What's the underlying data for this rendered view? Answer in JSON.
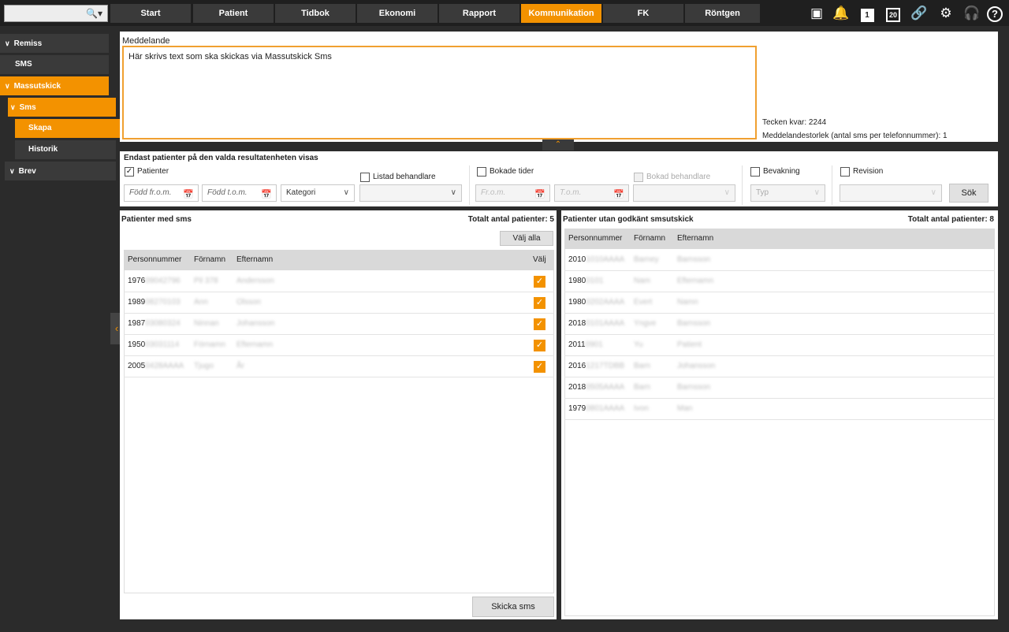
{
  "topbar": {
    "tabs": [
      {
        "label": "Start",
        "active": false
      },
      {
        "label": "Patient",
        "active": false
      },
      {
        "label": "Tidbok",
        "active": false
      },
      {
        "label": "Ekonomi",
        "active": false
      },
      {
        "label": "Rapport",
        "active": false
      },
      {
        "label": "Kommunikation",
        "active": true
      },
      {
        "label": "FK",
        "active": false
      },
      {
        "label": "Röntgen",
        "active": false
      }
    ],
    "date_badge": "20",
    "note_badge": "1",
    "accent_color": "#f39200"
  },
  "sidebar": {
    "items": [
      {
        "label": "Remiss"
      },
      {
        "label": "SMS"
      },
      {
        "label": "Massutskick"
      },
      {
        "label": "Sms"
      },
      {
        "label": "Skapa"
      },
      {
        "label": "Historik"
      },
      {
        "label": "Brev"
      }
    ]
  },
  "message": {
    "label": "Meddelande",
    "text": "Här skrivs text som ska skickas via Massutskick Sms",
    "chars_left": "Tecken kvar: 2244",
    "size_info": "Meddelandestorlek (antal sms per telefonnummer): 1"
  },
  "filter": {
    "heading": "Endast patienter på den valda resultatenheten visas",
    "patienter_label": "Patienter",
    "fodd_from_placeholder": "Född fr.o.m.",
    "fodd_tom_placeholder": "Född t.o.m.",
    "kategori_label": "Kategori",
    "listad_label": "Listad behandlare",
    "bokade_label": "Bokade tider",
    "from_placeholder": "Fr.o.m.",
    "tom_placeholder": "T.o.m.",
    "bokad_label": "Bokad behandlare",
    "bevakning_label": "Bevakning",
    "typ_label": "Typ",
    "revision_label": "Revision",
    "search_button": "Sök"
  },
  "left_table": {
    "title": "Patienter med sms",
    "total": "Totalt antal patienter: 5",
    "select_all": "Välj alla",
    "headers": {
      "pnr": "Personnummer",
      "first": "Förnamn",
      "last": "Efternamn",
      "select": "Välj"
    },
    "rows": [
      {
        "pnr_prefix": "1976",
        "pnr_rest": "09042796",
        "first": "Pil 378",
        "last": "Andersson"
      },
      {
        "pnr_prefix": "1989",
        "pnr_rest": "08270103",
        "first": "Ann",
        "last": "Olsson"
      },
      {
        "pnr_prefix": "1987",
        "pnr_rest": "03080324",
        "first": "Ninnan",
        "last": "Johansson"
      },
      {
        "pnr_prefix": "1950",
        "pnr_rest": "03031114",
        "first": "Förnamn",
        "last": "Efternamn"
      },
      {
        "pnr_prefix": "2005",
        "pnr_rest": "0428AAAA",
        "first": "Tjugo",
        "last": "År"
      }
    ],
    "send_button": "Skicka sms"
  },
  "right_table": {
    "title": "Patienter utan godkänt smsutskick",
    "total": "Totalt antal patienter: 8",
    "headers": {
      "pnr": "Personnummer",
      "first": "Förnamn",
      "last": "Efternamn"
    },
    "rows": [
      {
        "pnr_prefix": "2010",
        "pnr_rest": "1010AAAA",
        "first": "Barney",
        "last": "Barnsson"
      },
      {
        "pnr_prefix": "1980",
        "pnr_rest": "0101",
        "first": "Nam",
        "last": "Efternamn"
      },
      {
        "pnr_prefix": "1980",
        "pnr_rest": "0202AAAA",
        "first": "Evert",
        "last": "Namn"
      },
      {
        "pnr_prefix": "2018",
        "pnr_rest": "0101AAAA",
        "first": "Yngve",
        "last": "Barnsson"
      },
      {
        "pnr_prefix": "2011",
        "pnr_rest": "0901",
        "first": "Yu",
        "last": "Patient"
      },
      {
        "pnr_prefix": "2016",
        "pnr_rest": "1217TDBB",
        "first": "Barn",
        "last": "Johansson"
      },
      {
        "pnr_prefix": "2018",
        "pnr_rest": "0505AAAA",
        "first": "Barn",
        "last": "Barnsson"
      },
      {
        "pnr_prefix": "1979",
        "pnr_rest": "0801AAAA",
        "first": "Ivon",
        "last": "Man"
      }
    ]
  }
}
